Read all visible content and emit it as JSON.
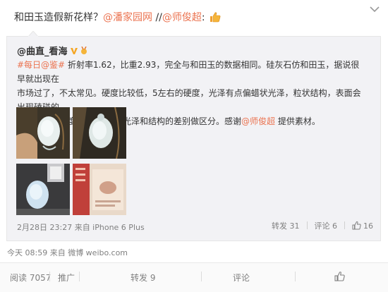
{
  "post": {
    "text": "和田玉造假新花样？",
    "mention1": "@潘家园网",
    "sep": "//",
    "mention2": "@师俊超",
    "colon": ":",
    "emoji": "thumbs-up-icon"
  },
  "repost": {
    "author": "@曲直_看海",
    "line1_tag": "#每日@鉴#",
    "line1": "折射率1.62，比重2.93，完全与和田玉的数据相同。硅灰石仿和田玉，据说很早就出现在",
    "line2": "市场过了，不太常见。硬度比较低，5左右的硬度，光泽有点偏蜡状光泽，粒状结构，表面会出现磕碰的",
    "line3_a": "白点痕迹（硬度低）。可通过光泽和结构的差别做区分。感谢",
    "line3_mention": "@师俊超",
    "line3_b": " 提供素材。",
    "footer": "2月28日 23:27 来自 iPhone 6 Plus",
    "repost_count": "转发 31",
    "comment_count": "评论 6",
    "like_count": "16"
  },
  "meta": "今天 08:59 来自 微博 weibo.com",
  "bottom": {
    "reads": "阅读 7057",
    "promote": "推广",
    "forward": "转发 9",
    "comment": "评论"
  },
  "colors": {
    "link": "#eb7350",
    "gray": "#808080",
    "box": "#f2f2f5"
  }
}
